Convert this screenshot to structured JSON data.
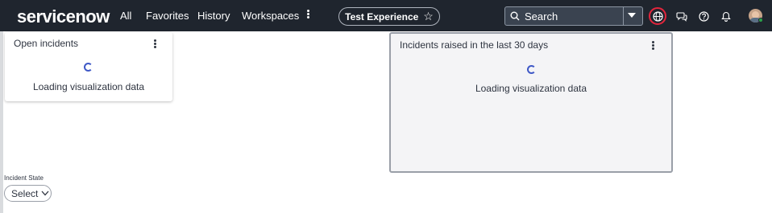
{
  "header": {
    "logo": "servicenow",
    "nav": [
      "All",
      "Favorites",
      "History",
      "Workspaces"
    ],
    "experience": "Test Experience",
    "search_placeholder": "Search"
  },
  "widgets": [
    {
      "title": "Open incidents",
      "loading_text": "Loading visualization data"
    },
    {
      "title": "Incidents raised in the last 30 days",
      "loading_text": "Loading visualization data"
    }
  ],
  "filter": {
    "label": "Incident State",
    "value": "Select"
  },
  "colors": {
    "topbar": "#1f252e",
    "accent_ring": "#e3253c",
    "spinner": "#3e58c6",
    "status": "#2ba24a"
  }
}
